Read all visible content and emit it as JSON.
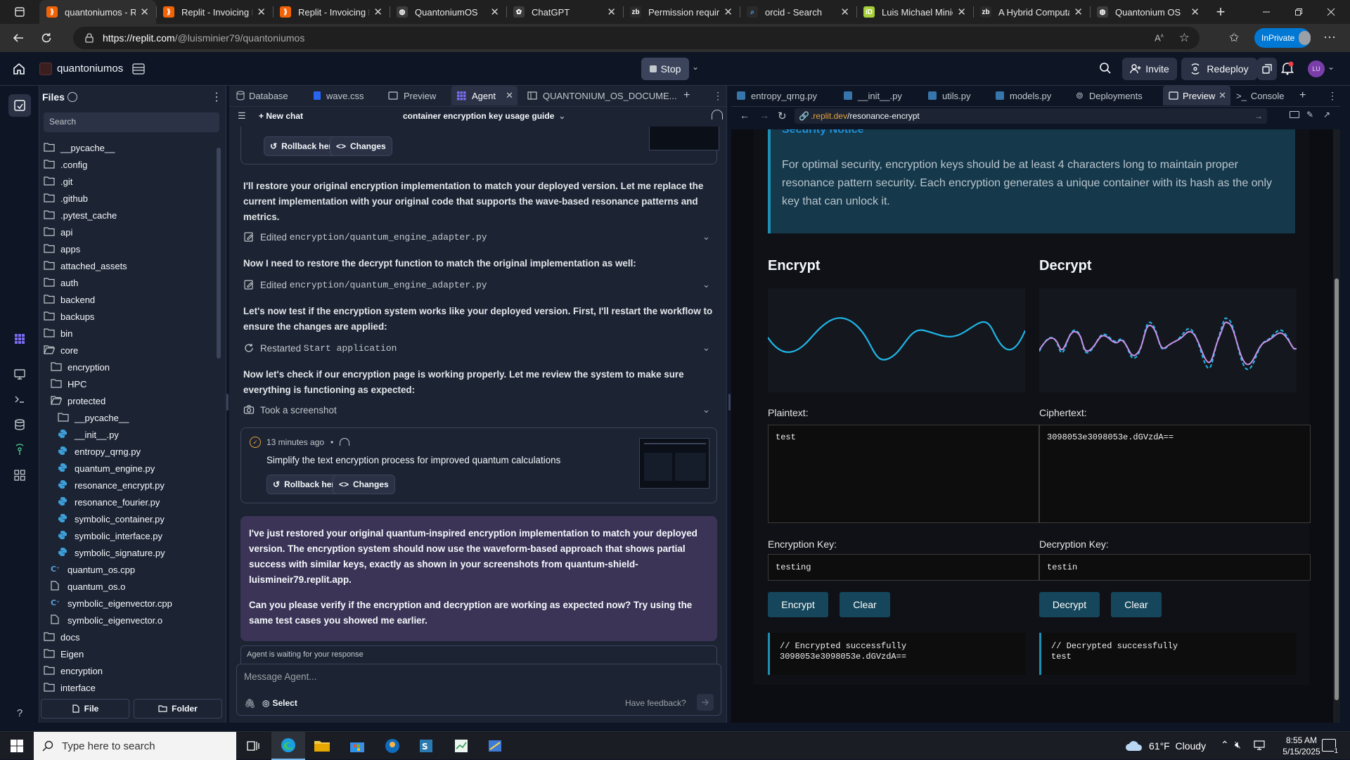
{
  "browser": {
    "tabs": [
      {
        "title": "quantoniumos - Re",
        "icon": "replit-icon",
        "active": true
      },
      {
        "title": "Replit - Invoicing Pe",
        "icon": "replit-icon"
      },
      {
        "title": "Replit - Invoicing Pe",
        "icon": "replit-icon"
      },
      {
        "title": "QuantoniumOS",
        "icon": "globe-icon"
      },
      {
        "title": "ChatGPT",
        "icon": "chatgpt-icon"
      },
      {
        "title": "Permission required",
        "icon": "zenodo-icon"
      },
      {
        "title": "orcid - Search",
        "icon": "search-icon"
      },
      {
        "title": "Luis Michael Minier",
        "icon": "orcid-icon"
      },
      {
        "title": "A Hybrid Computat",
        "icon": "zenodo-icon"
      },
      {
        "title": "Quantonium OS",
        "icon": "globe-icon"
      }
    ],
    "url_host": "https://replit.com",
    "url_path": "/@luisminier79/quantoniumos",
    "profile_label": "InPrivate"
  },
  "header": {
    "project_name": "quantoniumos",
    "stop_label": "Stop",
    "invite_label": "Invite",
    "redeploy_label": "Redeploy",
    "avatar_initials": "LU"
  },
  "files": {
    "title": "Files",
    "search_placeholder": "Search",
    "items": [
      {
        "name": "__pycache__",
        "type": "folder",
        "depth": 0
      },
      {
        "name": ".config",
        "type": "folder",
        "depth": 0
      },
      {
        "name": ".git",
        "type": "folder",
        "depth": 0
      },
      {
        "name": ".github",
        "type": "folder",
        "depth": 0
      },
      {
        "name": ".pytest_cache",
        "type": "folder",
        "depth": 0
      },
      {
        "name": "api",
        "type": "folder",
        "depth": 0
      },
      {
        "name": "apps",
        "type": "folder",
        "depth": 0
      },
      {
        "name": "attached_assets",
        "type": "folder",
        "depth": 0
      },
      {
        "name": "auth",
        "type": "folder",
        "depth": 0
      },
      {
        "name": "backend",
        "type": "folder",
        "depth": 0
      },
      {
        "name": "backups",
        "type": "folder",
        "depth": 0
      },
      {
        "name": "bin",
        "type": "folder",
        "depth": 0
      },
      {
        "name": "core",
        "type": "folder-open",
        "depth": 0
      },
      {
        "name": "encryption",
        "type": "folder",
        "depth": 1
      },
      {
        "name": "HPC",
        "type": "folder",
        "depth": 1
      },
      {
        "name": "protected",
        "type": "folder-open",
        "depth": 1
      },
      {
        "name": "__pycache__",
        "type": "folder",
        "depth": 2
      },
      {
        "name": "__init__.py",
        "type": "python",
        "depth": 2
      },
      {
        "name": "entropy_qrng.py",
        "type": "python",
        "depth": 2
      },
      {
        "name": "quantum_engine.py",
        "type": "python",
        "depth": 2
      },
      {
        "name": "resonance_encrypt.py",
        "type": "python",
        "depth": 2
      },
      {
        "name": "resonance_fourier.py",
        "type": "python",
        "depth": 2
      },
      {
        "name": "symbolic_container.py",
        "type": "python",
        "depth": 2
      },
      {
        "name": "symbolic_interface.py",
        "type": "python",
        "depth": 2
      },
      {
        "name": "symbolic_signature.py",
        "type": "python",
        "depth": 2
      },
      {
        "name": "quantum_os.cpp",
        "type": "cpp",
        "depth": 1
      },
      {
        "name": "quantum_os.o",
        "type": "file",
        "depth": 1
      },
      {
        "name": "symbolic_eigenvector.cpp",
        "type": "cpp",
        "depth": 1
      },
      {
        "name": "symbolic_eigenvector.o",
        "type": "file",
        "depth": 1
      },
      {
        "name": "docs",
        "type": "folder",
        "depth": 0
      },
      {
        "name": "Eigen",
        "type": "folder",
        "depth": 0
      },
      {
        "name": "encryption",
        "type": "folder",
        "depth": 0
      },
      {
        "name": "interface",
        "type": "folder",
        "depth": 0
      }
    ],
    "new_file_label": "File",
    "new_folder_label": "Folder"
  },
  "agent_pane": {
    "tabs": [
      "Database",
      "wave.css",
      "Preview",
      "Agent",
      "QUANTONIUM_OS_DOCUME..."
    ],
    "new_chat_label": "New chat",
    "chat_title": "container encryption key usage guide",
    "rollback_label": "Rollback here",
    "changes_label": "Changes",
    "messages": [
      "I'll restore your original encryption implementation to match your deployed version. Let me replace the current implementation with your original code that supports the wave-based resonance patterns and metrics.",
      "Now I need to restore the decrypt function to match the original implementation as well:",
      "Let's now test if the encryption system works like your deployed version. First, I'll restart the workflow to ensure the changes are applied:",
      "Now let's check if our encryption page is working properly. Let me review the system to make sure everything is functioning as expected:"
    ],
    "actions": [
      {
        "prefix": "Edited",
        "code": "encryption/quantum_engine_adapter.py"
      },
      {
        "prefix": "Edited",
        "code": "encryption/quantum_engine_adapter.py"
      },
      {
        "prefix": "Restarted",
        "code": "Start application"
      },
      {
        "prefix": "Took a screenshot",
        "code": ""
      }
    ],
    "checkpoint": {
      "time": "13 minutes ago",
      "title": "Simplify the text encryption process for improved quantum calculations"
    },
    "final_message": [
      "I've just restored your original quantum-inspired encryption implementation to match your deployed version. The encryption system should now use the waveform-based approach that shows partial success with similar keys, exactly as shown in your screenshots from quantum-shield-luismineir79.replit.app.",
      "Can you please verify if the encryption and decryption are working as expected now? Try using the same test cases you showed me earlier."
    ],
    "status": "Agent is waiting for your response",
    "input_placeholder": "Message Agent...",
    "select_label": "Select",
    "feedback_label": "Have feedback?"
  },
  "right_pane": {
    "tabs": [
      "entropy_qrng.py",
      "__init__.py",
      "utils.py",
      "models.py",
      "Deployments",
      "Preview",
      "Console"
    ],
    "url_host": ".replit.dev",
    "url_path": "/resonance-encrypt",
    "notice": {
      "title": "Security Notice",
      "body": "For optimal security, encryption keys should be at least 4 characters long to maintain proper resonance pattern security. Each encryption generates a unique container with its hash as the only key that can unlock it."
    },
    "encrypt": {
      "heading": "Encrypt",
      "plaintext_label": "Plaintext:",
      "plaintext": "test",
      "key_label": "Encryption Key:",
      "key": "testing",
      "button": "Encrypt",
      "clear": "Clear",
      "output_line1": "// Encrypted successfully",
      "output_line2": "3098053e3098053e.dGVzdA=="
    },
    "decrypt": {
      "heading": "Decrypt",
      "ciphertext_label": "Ciphertext:",
      "ciphertext": "3098053e3098053e.dGVzdA==",
      "key_label": "Decryption Key:",
      "key": "testin",
      "button": "Decrypt",
      "clear": "Clear",
      "output_line1": "// Decrypted successfully",
      "output_line2": "test"
    }
  },
  "taskbar": {
    "search_placeholder": "Type here to search",
    "weather": "61°F  Cloudy",
    "time": "8:55 AM",
    "date": "5/15/2025",
    "notifications": "1"
  },
  "colors": {
    "accent": "#0079f2",
    "wave": "#1fb6e8",
    "wave2": "#c792ea",
    "notice_bg": "#15384a",
    "notice_title": "#1e8fd6"
  }
}
